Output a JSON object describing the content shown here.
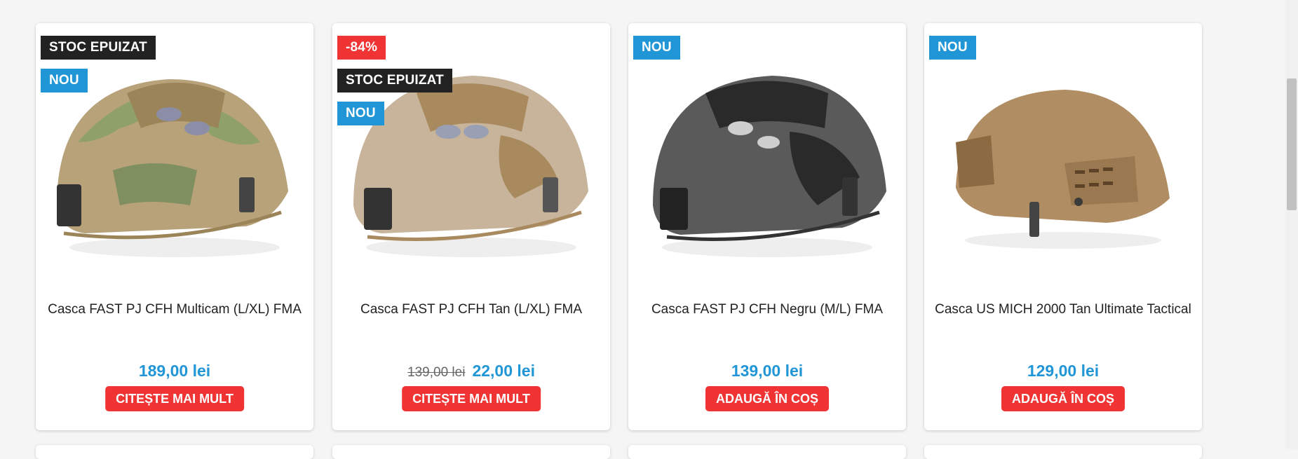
{
  "products": [
    {
      "title": "Casca FAST PJ CFH Multicam (L/XL) FMA",
      "badges": [
        {
          "text": "STOC EPUIZAT",
          "style": "dark"
        },
        {
          "text": "NOU",
          "style": "blue"
        }
      ],
      "old_price": "",
      "price": "189,00 lei",
      "button": "CITEȘTE MAI MULT",
      "helmet_color": "#b8a27a",
      "helmet_accent": "#8fa06b"
    },
    {
      "title": "Casca FAST PJ CFH Tan (L/XL) FMA",
      "badges": [
        {
          "text": "-84%",
          "style": "red"
        },
        {
          "text": "STOC EPUIZAT",
          "style": "dark"
        },
        {
          "text": "NOU",
          "style": "blue"
        }
      ],
      "old_price": "139,00 lei",
      "price": "22,00 lei",
      "button": "CITEȘTE MAI MULT",
      "helmet_color": "#c7b49b",
      "helmet_accent": "#a88a5e"
    },
    {
      "title": "Casca FAST PJ CFH Negru (M/L) FMA",
      "badges": [
        {
          "text": "NOU",
          "style": "blue"
        }
      ],
      "old_price": "",
      "price": "139,00 lei",
      "button": "ADAUGĂ ÎN COȘ",
      "helmet_color": "#5a5a5a",
      "helmet_accent": "#2a2a2a"
    },
    {
      "title": "Casca US MICH 2000 Tan Ultimate Tactical",
      "badges": [
        {
          "text": "NOU",
          "style": "blue"
        }
      ],
      "old_price": "",
      "price": "129,00 lei",
      "button": "ADAUGĂ ÎN COȘ",
      "helmet_color": "#b08d62",
      "helmet_accent": "#8c6a42"
    }
  ],
  "colors": {
    "accent": "#2196d6",
    "button": "#f03333",
    "dark_badge": "#222222"
  }
}
